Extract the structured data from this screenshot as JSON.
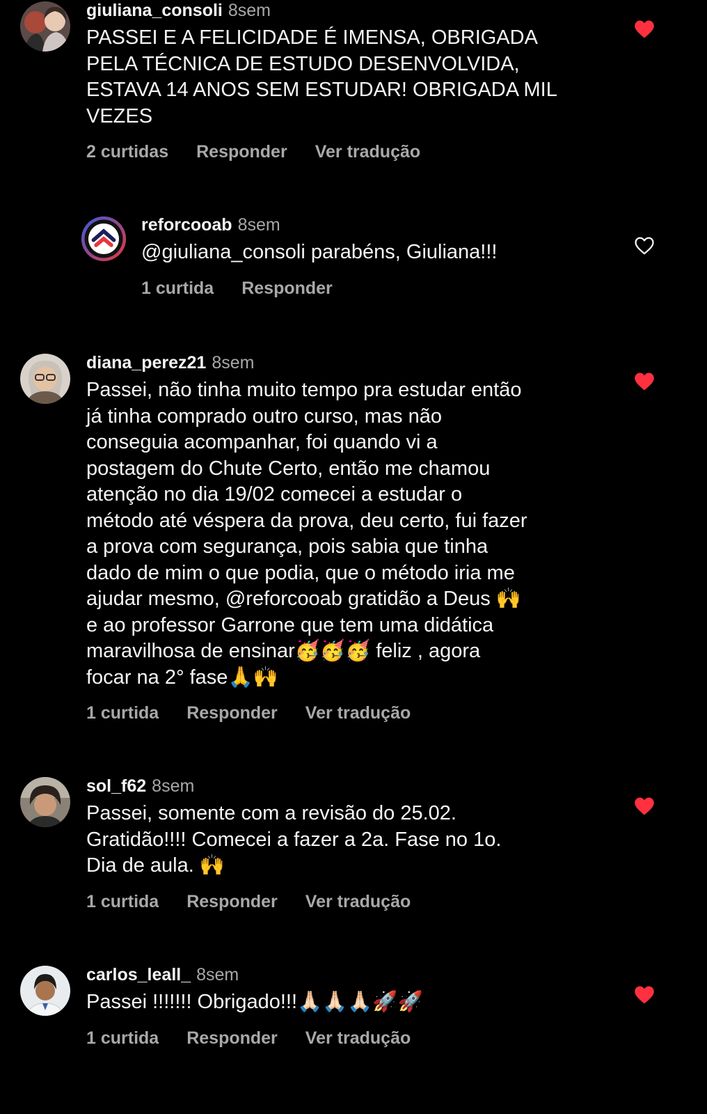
{
  "comments": [
    {
      "username": "giuliana_consoli",
      "time": "8sem",
      "text": "PASSEI E A FELICIDADE É IMENSA, OBRIGADA\nPELA TÉCNICA DE ESTUDO DESENVOLVIDA,\nESTAVA 14 ANOS SEM ESTUDAR! OBRIGADA MIL\nVEZES",
      "likes": "2 curtidas",
      "reply": "Responder",
      "translate": "Ver tradução",
      "liked": true
    },
    {
      "username": "reforcooab",
      "time": "8sem",
      "text": "@giuliana_consoli parabéns, Giuliana!!!",
      "likes": "1 curtida",
      "reply": "Responder",
      "liked": false
    },
    {
      "username": "diana_perez21",
      "time": "8sem",
      "text": "Passei, não tinha muito tempo pra estudar então\njá tinha comprado outro curso, mas não\nconseguia acompanhar, foi quando vi a\npostagem do Chute Certo, então me chamou\natenção no dia 19/02 comecei a estudar o\nmétodo até véspera da prova, deu certo, fui fazer\na prova com segurança, pois sabia que tinha\ndado de mim o que podia, que o método iria me\najudar mesmo, @reforcooab gratidão a Deus 🙌\ne ao professor Garrone que tem uma didática\nmaravilhosa de ensinar🥳🥳🥳 feliz , agora\nfocar na 2° fase🙏🙌",
      "likes": "1 curtida",
      "reply": "Responder",
      "translate": "Ver tradução",
      "liked": true
    },
    {
      "username": "sol_f62",
      "time": "8sem",
      "text": "Passei,  somente com a revisão  do 25.02.\nGratidão!!!! Comecei  a fazer  a 2a. Fase no 1o.\nDia de aula. 🙌",
      "likes": "1 curtida",
      "reply": "Responder",
      "translate": "Ver tradução",
      "liked": true
    },
    {
      "username": "carlos_leall_",
      "time": "8sem",
      "text": "Passei !!!!!!! Obrigado!!!🙏🏻🙏🏻🙏🏻🚀🚀",
      "likes": "1 curtida",
      "reply": "Responder",
      "translate": "Ver tradução",
      "liked": true
    }
  ],
  "colors": {
    "background": "#000000",
    "text": "#f5f5f5",
    "secondary": "#a8a8a8",
    "heart_liked": "#ff3040"
  }
}
